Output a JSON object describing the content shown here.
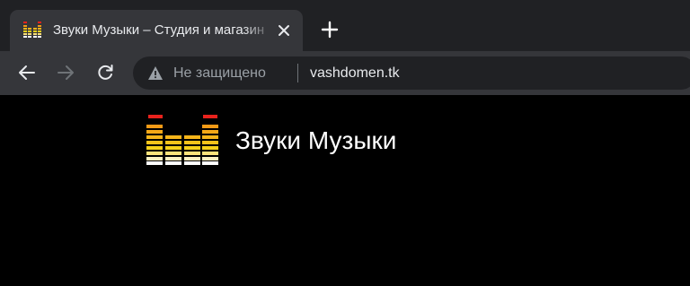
{
  "browser": {
    "tab": {
      "title": "Звуки Музыки – Студия и магазин",
      "favicon": "equalizer-icon"
    },
    "new_tab_icon": "plus-icon",
    "close_icon": "close-icon",
    "nav": {
      "back_icon": "arrow-left-icon",
      "forward_icon": "arrow-right-icon",
      "reload_icon": "reload-icon"
    },
    "omnibox": {
      "security_icon": "warning-icon",
      "security_label": "Не защищено",
      "url": "vashdomen.tk"
    }
  },
  "site": {
    "logo": "equalizer-icon",
    "title": "Звуки Музыки"
  },
  "colors": {
    "tabstrip_bg": "#202124",
    "toolbar_bg": "#35363a",
    "page_bg": "#000000",
    "eq_red": "#e8221c",
    "eq_orange": "#f39a16",
    "eq_yellow": "#f7d11a",
    "eq_white": "#ffffff"
  }
}
